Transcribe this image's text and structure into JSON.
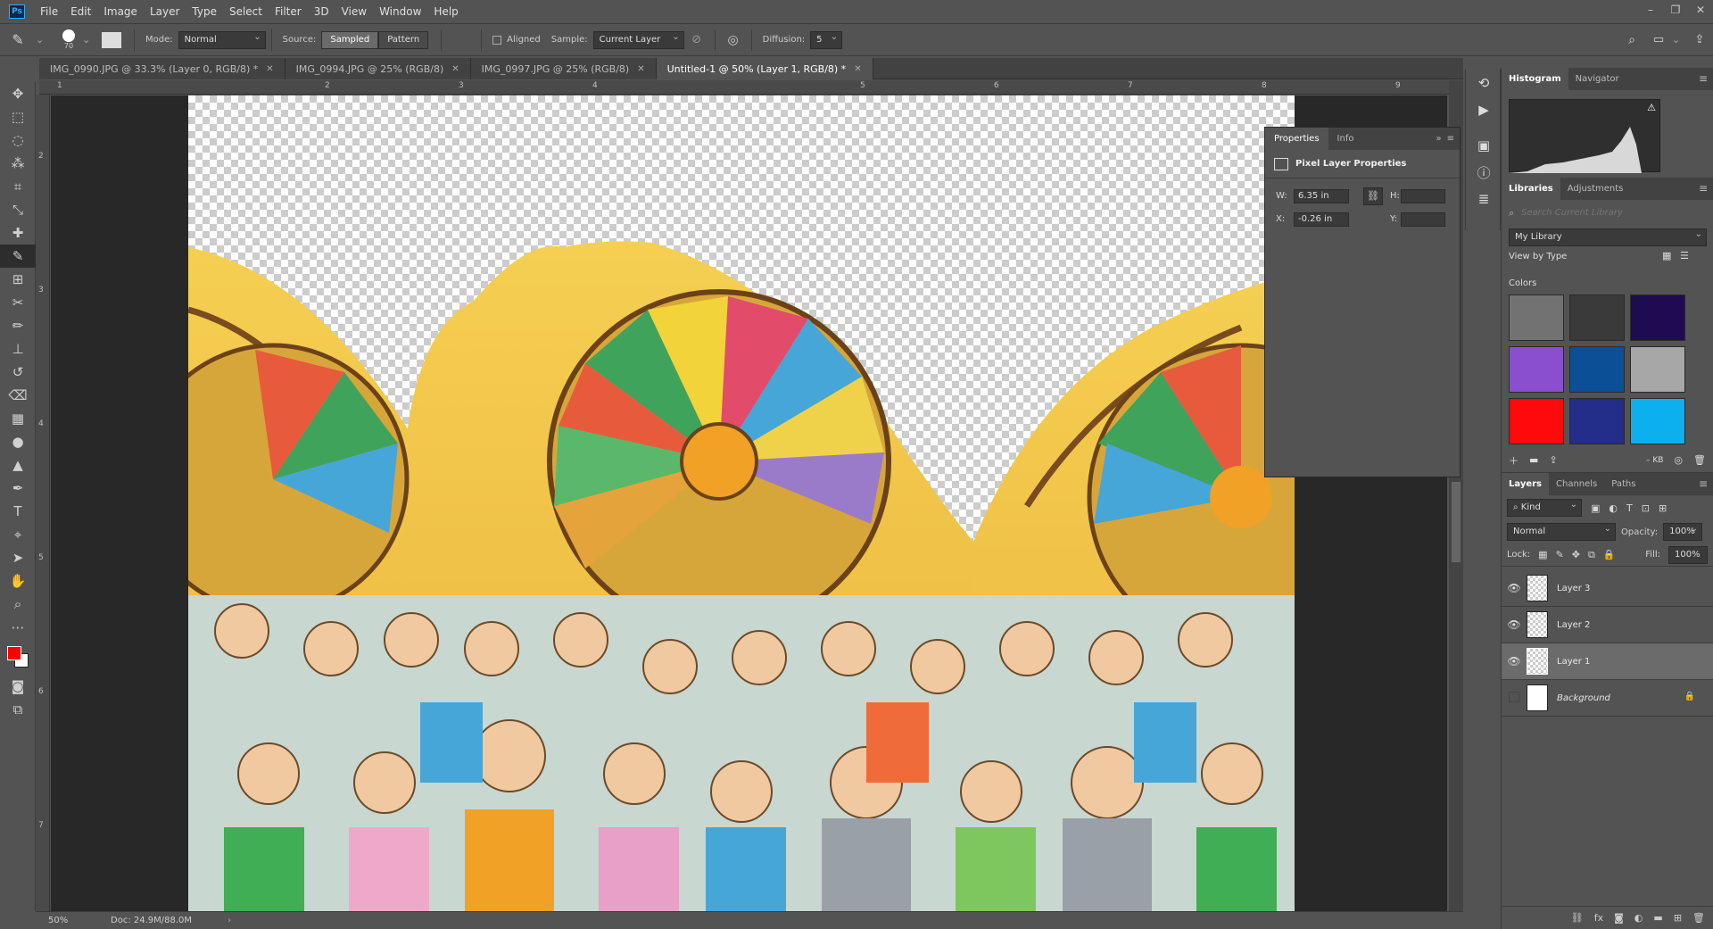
{
  "app": {
    "logo": "Ps"
  },
  "menu": [
    "File",
    "Edit",
    "Image",
    "Layer",
    "Type",
    "Select",
    "Filter",
    "3D",
    "View",
    "Window",
    "Help"
  ],
  "window_controls": [
    "–",
    "❐",
    "✕"
  ],
  "options": {
    "brush_size": "70",
    "mode_label": "Mode:",
    "mode_value": "Normal",
    "source_label": "Source:",
    "source_sampled": "Sampled",
    "source_pattern": "Pattern",
    "aligned_label": "Aligned",
    "sample_label": "Sample:",
    "sample_value": "Current Layer",
    "diffusion_label": "Diffusion:",
    "diffusion_value": "5"
  },
  "tabs": [
    {
      "label": "IMG_0990.JPG @ 33.3% (Layer 0, RGB/8) *"
    },
    {
      "label": "IMG_0994.JPG @ 25% (RGB/8)"
    },
    {
      "label": "IMG_0997.JPG @ 25% (RGB/8)"
    },
    {
      "label": "Untitled-1 @ 50% (Layer 1, RGB/8) *"
    }
  ],
  "ruler_top": [
    "1",
    "2",
    "3",
    "4",
    "5",
    "6",
    "7",
    "8",
    "9"
  ],
  "ruler_left": [
    "2",
    "3",
    "4",
    "5",
    "6",
    "7"
  ],
  "status": {
    "zoom": "50%",
    "doc": "Doc: 24.9M/88.0M"
  },
  "properties": {
    "tab_properties": "Properties",
    "tab_info": "Info",
    "section_title": "Pixel Layer Properties",
    "w_label": "W:",
    "w_value": "6.35 in",
    "h_label": "H:",
    "x_label": "X:",
    "x_value": "-0.26 in",
    "y_label": "Y:"
  },
  "histogram": {
    "tab": "Histogram",
    "tab2": "Navigator"
  },
  "libraries": {
    "tab": "Libraries",
    "tab2": "Adjustments",
    "search_placeholder": "Search Current Library",
    "library_name": "My Library",
    "view_by": "View by Type",
    "colors_label": "Colors",
    "kb": "– KB"
  },
  "swatches": [
    "#727272",
    "#3a3a3a",
    "#1e0b52",
    "#8a4fcf",
    "#0b4f96",
    "#a7a7a7",
    "#ff0a0a",
    "#232d8a",
    "#0bb0ec"
  ],
  "layers_panel": {
    "tab": "Layers",
    "tab2": "Channels",
    "tab3": "Paths",
    "kind_label": "Kind",
    "blend_mode": "Normal",
    "opacity_label": "Opacity:",
    "opacity_value": "100%",
    "lock_label": "Lock:",
    "fill_label": "Fill:",
    "fill_value": "100%"
  },
  "layers": [
    {
      "name": "Layer 3",
      "visible": true
    },
    {
      "name": "Layer 2",
      "visible": true
    },
    {
      "name": "Layer 1",
      "visible": true,
      "active": true
    },
    {
      "name": "Background",
      "visible": false,
      "locked": true
    }
  ]
}
